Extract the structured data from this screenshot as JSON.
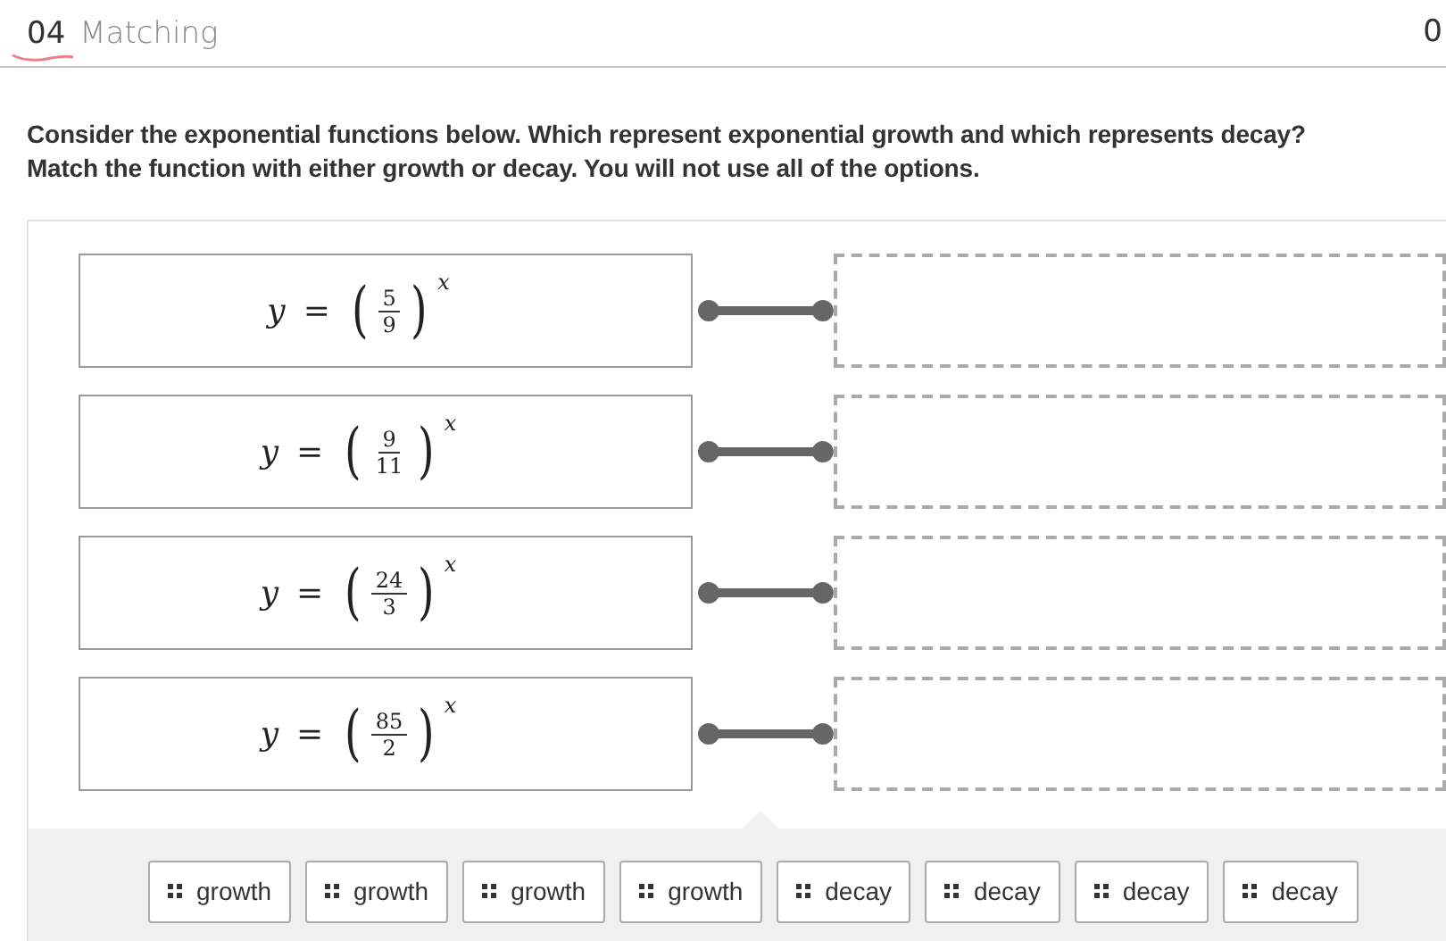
{
  "header": {
    "number": "04",
    "title": "Matching",
    "score": "0"
  },
  "prompt": "Consider the exponential functions below. Which represent exponential growth and which represents decay? Match the function with either growth or decay. You will not use all of the options.",
  "pairs": [
    {
      "formula": {
        "variable": "y",
        "equals": "=",
        "open": "(",
        "numerator": "5",
        "denominator": "9",
        "close": ")",
        "exponent": "x"
      }
    },
    {
      "formula": {
        "variable": "y",
        "equals": "=",
        "open": "(",
        "numerator": "9",
        "denominator": "11",
        "close": ")",
        "exponent": "x"
      }
    },
    {
      "formula": {
        "variable": "y",
        "equals": "=",
        "open": "(",
        "numerator": "24",
        "denominator": "3",
        "close": ")",
        "exponent": "x"
      }
    },
    {
      "formula": {
        "variable": "y",
        "equals": "=",
        "open": "(",
        "numerator": "85",
        "denominator": "2",
        "close": ")",
        "exponent": "x"
      }
    }
  ],
  "options": [
    "growth",
    "growth",
    "growth",
    "growth",
    "decay",
    "decay",
    "decay",
    "decay"
  ]
}
